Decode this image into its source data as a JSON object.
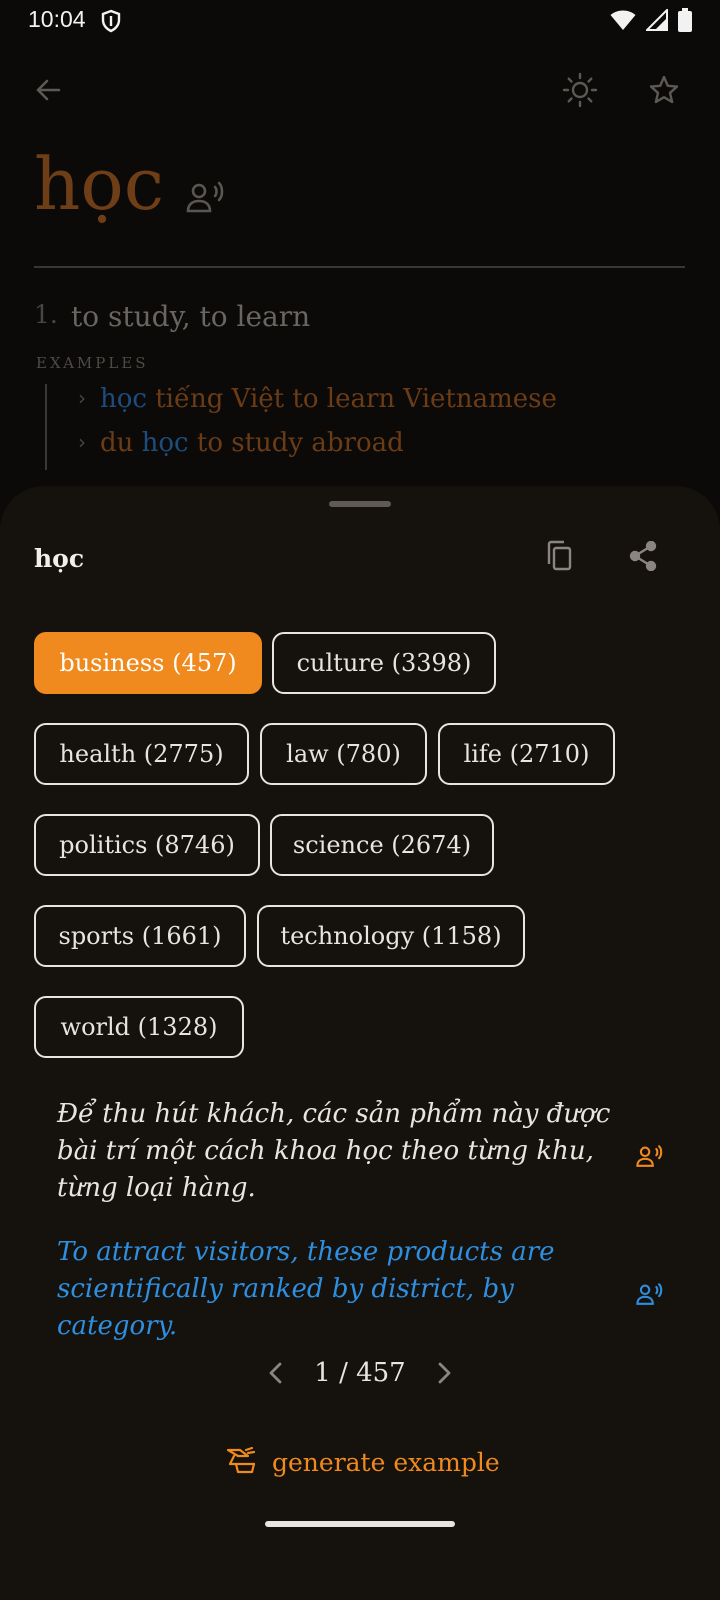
{
  "status": {
    "time": "10:04"
  },
  "entry": {
    "word": "học",
    "definition_number": "1.",
    "definition": "to study, to learn",
    "examples_label": "EXAMPLES",
    "examples": [
      {
        "highlight": "học",
        "after": " tiếng Việt to learn Vietnamese",
        "before": ""
      },
      {
        "before": "du ",
        "highlight": "học",
        "after": " to study abroad"
      }
    ]
  },
  "sheet": {
    "word": "học",
    "chips": [
      {
        "label": "business (457)",
        "active": true
      },
      {
        "label": "culture (3398)",
        "active": false
      },
      {
        "label": "health (2775)",
        "active": false
      },
      {
        "label": "law (780)",
        "active": false
      },
      {
        "label": "life (2710)",
        "active": false
      },
      {
        "label": "politics (8746)",
        "active": false
      },
      {
        "label": "science (2674)",
        "active": false
      },
      {
        "label": "sports (1661)",
        "active": false
      },
      {
        "label": "technology (1158)",
        "active": false
      },
      {
        "label": "world (1328)",
        "active": false
      }
    ],
    "sentence_vi": "Để thu hút khách, các sản phẩm này được bài trí một cách khoa học theo từng khu, từng loại hàng.",
    "sentence_en": "To attract visitors, these products are scientifically ranked by district, by category.",
    "pager": {
      "label": "1 / 457"
    },
    "generate_label": "generate example"
  },
  "colors": {
    "accent": "#f08a1e",
    "translation": "#2e8fe0",
    "background": "#0b0a09",
    "sheet": "#15110c"
  },
  "icons": [
    "shield-icon",
    "wifi-icon",
    "signal-icon",
    "battery-icon",
    "back-arrow-icon",
    "brightness-icon",
    "star-icon",
    "speaker-icon",
    "copy-icon",
    "share-icon",
    "chevron-left-icon",
    "chevron-right-icon",
    "generate-icon"
  ]
}
